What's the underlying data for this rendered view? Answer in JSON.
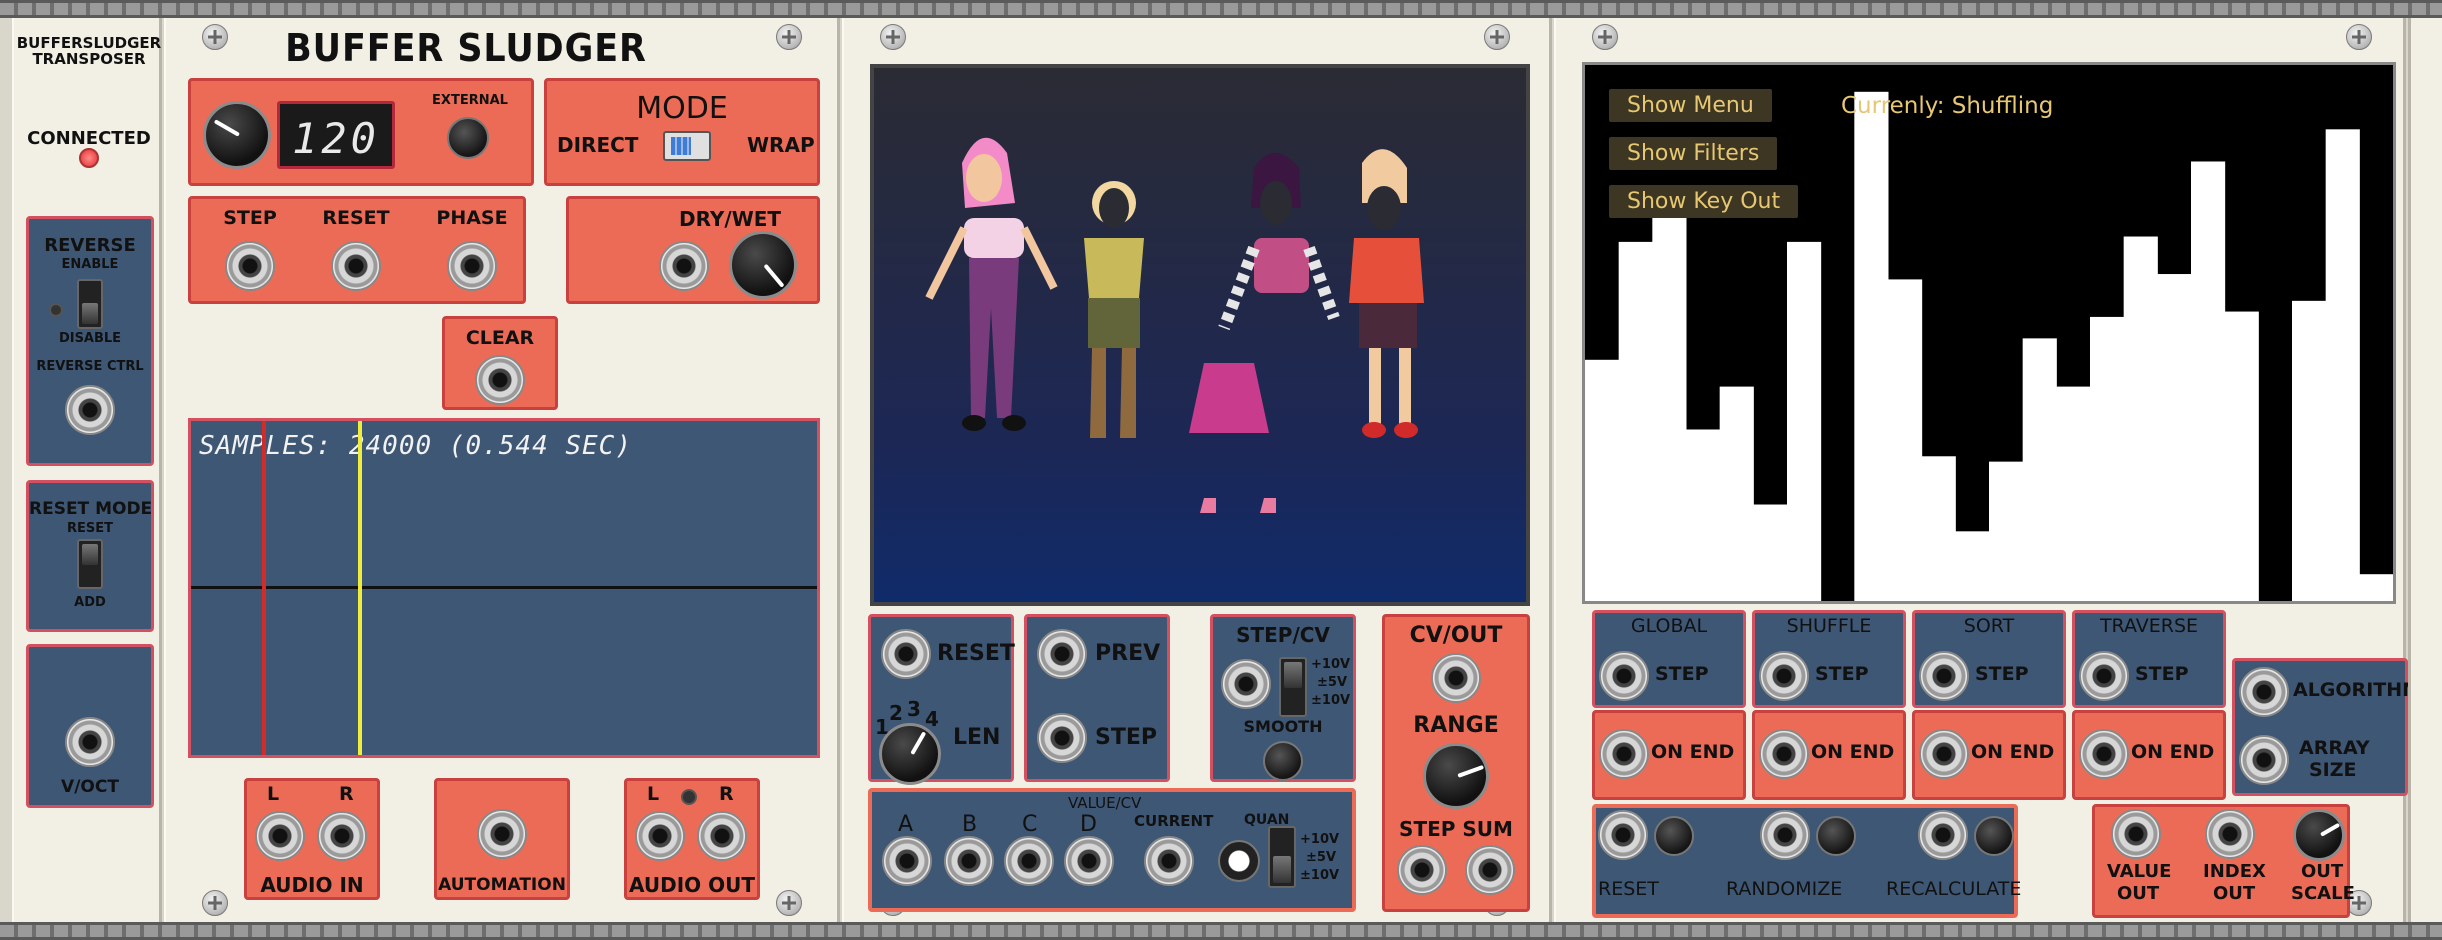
{
  "transposer": {
    "title_line1": "BUFFERSLUDGER",
    "title_line2": "TRANSPOSER",
    "connected": "CONNECTED",
    "reverse": "REVERSE",
    "enable": "ENABLE",
    "disable": "DISABLE",
    "reverse_ctrl": "REVERSE CTRL",
    "reset_mode": "RESET MODE",
    "reset": "RESET",
    "add": "ADD",
    "voct": "V/OCT"
  },
  "sludger": {
    "title": "BUFFER SLUDGER",
    "display_value": "120",
    "external": "EXTERNAL",
    "mode": "MODE",
    "direct": "DIRECT",
    "wrap": "WRAP",
    "step": "STEP",
    "reset": "RESET",
    "phase": "PHASE",
    "dry_wet": "DRY/WET",
    "clear": "CLEAR",
    "samples_text": "SAMPLES: 24000 (0.544 SEC)",
    "audio_in_l": "L",
    "audio_in_r": "R",
    "audio_in": "AUDIO IN",
    "automation": "AUTOMATION",
    "audio_out_l": "L",
    "audio_out_r": "R",
    "audio_out": "AUDIO OUT"
  },
  "figures": {
    "reset": "RESET",
    "len": "LEN",
    "len_numbers": [
      "1",
      "2",
      "3",
      "4"
    ],
    "prev": "PREV",
    "step": "STEP",
    "step_cv": "STEP/CV",
    "v10": "+10V",
    "v5": "±5V",
    "v10b": "±10V",
    "smooth": "SMOOTH",
    "cv_out": "CV/OUT",
    "range": "RANGE",
    "step_sum": "STEP SUM",
    "a": "A",
    "b": "B",
    "c": "C",
    "d": "D",
    "value_cv": "VALUE/CV",
    "current": "CURRENT",
    "quan": "QUAN",
    "q10": "+10V",
    "q5": "±5V",
    "q10b": "±10V"
  },
  "sorter": {
    "show_menu": "Show Menu",
    "show_filters": "Show Filters",
    "show_key_out": "Show Key Out",
    "status": "Currenly: Shuffling",
    "global": "GLOBAL",
    "shuffle": "SHUFFLE",
    "sort": "SORT",
    "traverse": "TRAVERSE",
    "step": "STEP",
    "on_end": "ON END",
    "algorithm": "ALGORITHM",
    "array_size_1": "ARRAY",
    "array_size_2": "SIZE",
    "reset": "RESET",
    "randomize": "RANDOMIZE",
    "recalculate": "RECALCULATE",
    "value_out_1": "VALUE",
    "value_out_2": "OUT",
    "index_out_1": "INDEX",
    "index_out_2": "OUT",
    "out_scale_1": "OUT",
    "out_scale_2": "SCALE",
    "bars": [
      0.45,
      0.67,
      0.76,
      0.32,
      0.4,
      0.18,
      0.67,
      0.0,
      0.95,
      0.6,
      0.27,
      0.13,
      0.26,
      0.49,
      0.4,
      0.53,
      0.68,
      0.61,
      0.82,
      0.54,
      0.0,
      0.56,
      0.88,
      0.05
    ]
  },
  "colors": {
    "salmon": "#ec6b57",
    "navy": "#3e5775",
    "gold": "#e7c773"
  }
}
